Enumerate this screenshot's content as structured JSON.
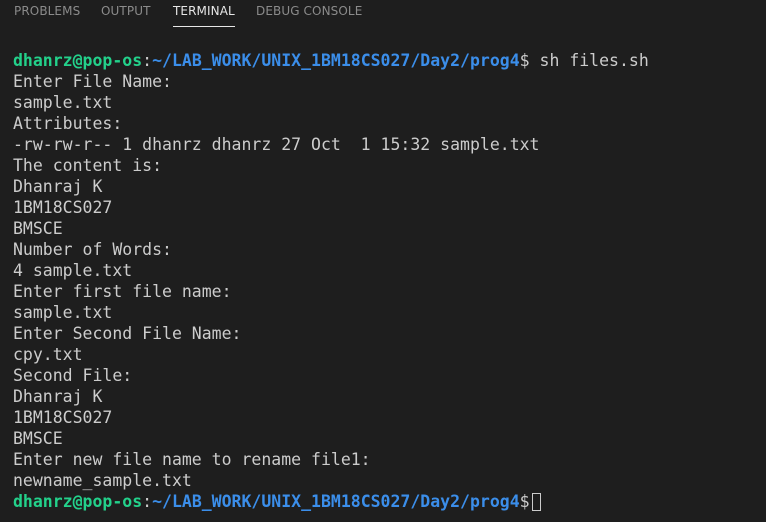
{
  "panel": {
    "tabs": [
      {
        "label": "PROBLEMS"
      },
      {
        "label": "OUTPUT"
      },
      {
        "label": "TERMINAL"
      },
      {
        "label": "DEBUG CONSOLE"
      }
    ],
    "active_tab": "TERMINAL"
  },
  "terminal": {
    "prompt": {
      "user": "dhanrz@pop-os",
      "separator": ":",
      "path": "~/LAB_WORK/UNIX_1BM18CS027/Day2/prog4",
      "dollar": "$"
    },
    "command": " sh files.sh",
    "output": [
      "Enter File Name:",
      "sample.txt",
      "Attributes:",
      "-rw-rw-r-- 1 dhanrz dhanrz 27 Oct  1 15:32 sample.txt",
      "The content is:",
      "Dhanraj K",
      "1BM18CS027",
      "BMSCE",
      "Number of Words:",
      "4 sample.txt",
      "Enter first file name:",
      "sample.txt",
      "Enter Second File Name:",
      "cpy.txt",
      "Second File:",
      "Dhanraj K",
      "1BM18CS027",
      "BMSCE",
      "Enter new file name to rename file1:",
      "newname_sample.txt"
    ]
  },
  "colors": {
    "background": "#1e1e1e",
    "prompt_user": "#23d18b",
    "prompt_path": "#3b8eea",
    "text": "#cccccc"
  }
}
